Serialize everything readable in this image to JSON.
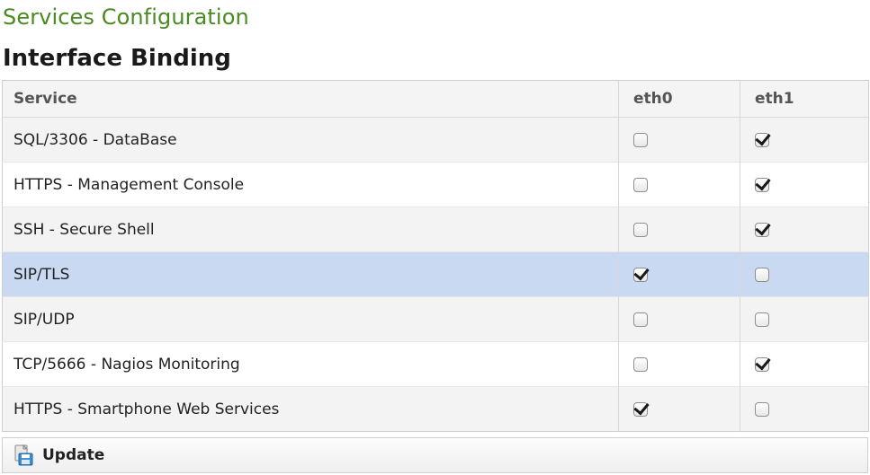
{
  "page": {
    "section_title": "Services Configuration",
    "subsection_title": "Interface Binding"
  },
  "table": {
    "headers": {
      "service": "Service",
      "eth0": "eth0",
      "eth1": "eth1"
    },
    "rows": [
      {
        "service": "SQL/3306 - DataBase",
        "eth0": false,
        "eth1": true,
        "selected": false
      },
      {
        "service": "HTTPS - Management Console",
        "eth0": false,
        "eth1": true,
        "selected": false
      },
      {
        "service": "SSH - Secure Shell",
        "eth0": false,
        "eth1": true,
        "selected": false
      },
      {
        "service": "SIP/TLS",
        "eth0": true,
        "eth1": false,
        "selected": true
      },
      {
        "service": "SIP/UDP",
        "eth0": false,
        "eth1": false,
        "selected": false
      },
      {
        "service": "TCP/5666 - Nagios Monitoring",
        "eth0": false,
        "eth1": true,
        "selected": false
      },
      {
        "service": "HTTPS - Smartphone Web Services",
        "eth0": true,
        "eth1": false,
        "selected": false
      }
    ]
  },
  "toolbar": {
    "update_label": "Update",
    "update_icon": "save-icon"
  },
  "colors": {
    "section_title": "#4a8a22",
    "selected_row": "#c9d9f2",
    "alt_row": "#f3f3f3"
  }
}
